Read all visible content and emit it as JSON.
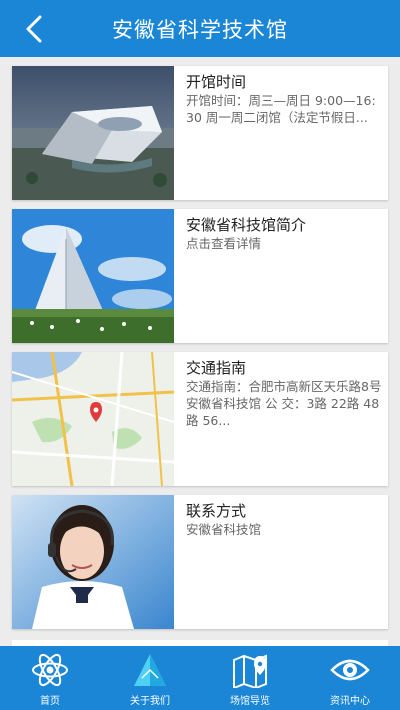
{
  "header": {
    "title": "安徽省科学技术馆",
    "back_icon": "chevron-left-icon"
  },
  "cards": [
    {
      "title": "开馆时间",
      "desc": "开馆时间：周三—周日 9:00—16:30 周一周二闭馆（法定节假日...",
      "image": "museum-building-photo"
    },
    {
      "title": "安徽省科技馆简介",
      "desc": "点击查看详情",
      "image": "pyramid-building-photo"
    },
    {
      "title": "交通指南",
      "desc": "交通指南：合肥市高新区天乐路8号安徽省科技馆 公 交：3路 22路 48路 56...",
      "image": "city-map-image"
    },
    {
      "title": "联系方式",
      "desc": "安徽省科技馆",
      "image": "customer-service-photo"
    }
  ],
  "tabbar": [
    {
      "label": "首页",
      "icon": "atom-icon"
    },
    {
      "label": "关于我们",
      "icon": "triangle-logo-icon"
    },
    {
      "label": "场馆导览",
      "icon": "map-pin-icon"
    },
    {
      "label": "资讯中心",
      "icon": "eye-icon"
    }
  ],
  "colors": {
    "primary": "#1b86d6",
    "background": "#ececec"
  }
}
